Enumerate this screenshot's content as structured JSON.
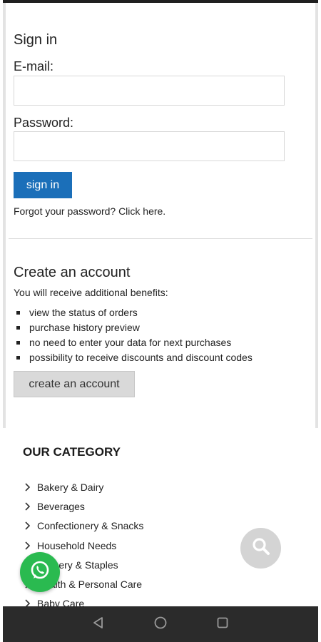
{
  "signin": {
    "title": "Sign in",
    "email_label": "E-mail:",
    "email_value": "",
    "password_label": "Password:",
    "password_value": "",
    "button_label": "sign in",
    "forgot_text": "Forgot your password? Click here."
  },
  "create_account": {
    "title": "Create an account",
    "intro": "You will receive additional benefits:",
    "benefits": [
      "view the status of orders",
      "purchase history preview",
      "no need to enter your data for next purchases",
      "possibility to receive discounts and discount codes"
    ],
    "button_label": "create an account"
  },
  "category": {
    "title": "OUR CATEGORY",
    "items": [
      "Bakery & Dairy",
      "Beverages",
      "Confectionery & Snacks",
      "Household Needs",
      "Grocery & Staples",
      "Health & Personal Care",
      "Baby Care"
    ]
  },
  "icons": {
    "search": "search-icon",
    "whatsapp": "whatsapp-icon",
    "nav_back": "back-triangle-icon",
    "nav_home": "home-circle-icon",
    "nav_recents": "recents-square-icon"
  },
  "colors": {
    "primary_button": "#1b6fb9",
    "secondary_button": "#d9d9d9",
    "whatsapp": "#2aba50",
    "search_fab": "#d4d4d4",
    "nav_bar": "#2b2b2b"
  }
}
